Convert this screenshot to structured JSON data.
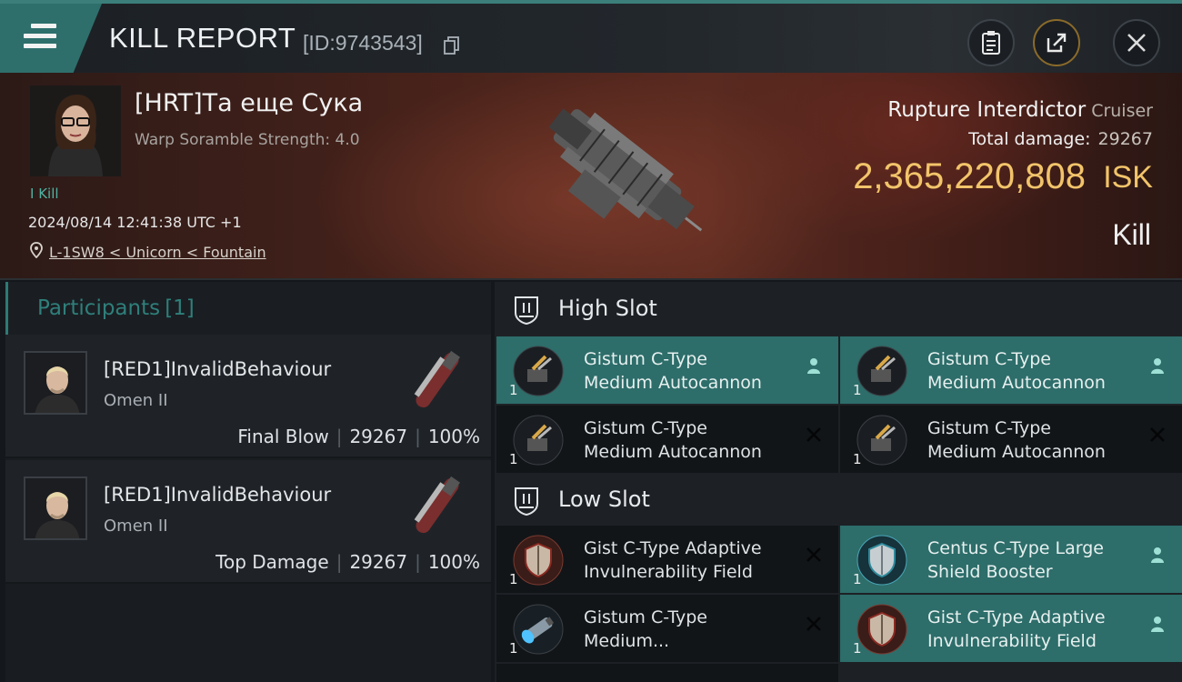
{
  "header": {
    "title": "KILL REPORT",
    "report_id": "[ID:9743543]"
  },
  "victim": {
    "pilot_name": "[HRT]Та еще Сука",
    "warp_strength": "Warp Soramble Strength: 4.0",
    "kill_tag": "I Kill",
    "timestamp": "2024/08/14 12:41:38 UTC +1",
    "location": "L-1SW8 < Unicorn < Fountain",
    "ship_name": "Rupture Interdictor",
    "ship_class": "Cruiser",
    "total_damage_label": "Total damage:",
    "total_damage": "29267",
    "isk_value": "2,365,220,808",
    "isk_label": "ISK",
    "result": "Kill"
  },
  "participants": {
    "label": "Participants",
    "count": "[1]",
    "items": [
      {
        "name": "[RED1]InvalidBehaviour",
        "ship": "Omen II",
        "role": "Final Blow",
        "damage": "29267",
        "percent": "100%"
      },
      {
        "name": "[RED1]InvalidBehaviour",
        "ship": "Omen II",
        "role": "Top Damage",
        "damage": "29267",
        "percent": "100%"
      }
    ]
  },
  "slots": {
    "high": {
      "label": "High Slot",
      "modules": [
        {
          "line1": "Gistum C-Type",
          "line2": "Medium Autocannon",
          "qty": "1",
          "status": "person"
        },
        {
          "line1": "Gistum C-Type",
          "line2": "Medium Autocannon",
          "qty": "1",
          "status": "person"
        },
        {
          "line1": "Gistum C-Type",
          "line2": "Medium Autocannon",
          "qty": "1",
          "status": "destroyed"
        },
        {
          "line1": "Gistum C-Type",
          "line2": "Medium Autocannon",
          "qty": "1",
          "status": "destroyed"
        }
      ]
    },
    "low": {
      "label": "Low Slot",
      "modules": [
        {
          "line1": "Gist C-Type Adaptive",
          "line2": "Invulnerability Field",
          "qty": "1",
          "status": "destroyed"
        },
        {
          "line1": "Centus C-Type Large",
          "line2": "Shield Booster",
          "qty": "1",
          "status": "person"
        },
        {
          "line1": "Gistum C-Type",
          "line2": "Medium...",
          "qty": "1",
          "status": "destroyed"
        },
        {
          "line1": "Gist C-Type Adaptive",
          "line2": "Invulnerability Field",
          "qty": "1",
          "status": "person"
        }
      ]
    }
  },
  "colors": {
    "accent_teal": "#2d6d6a",
    "isk_gold": "#f2c46a"
  },
  "icons": [
    "menu-icon",
    "copy-icon",
    "clipboard-icon",
    "share-icon",
    "close-icon",
    "location-pin-icon",
    "high-slot-icon",
    "low-slot-icon",
    "person-icon",
    "destroyed-x-icon"
  ]
}
